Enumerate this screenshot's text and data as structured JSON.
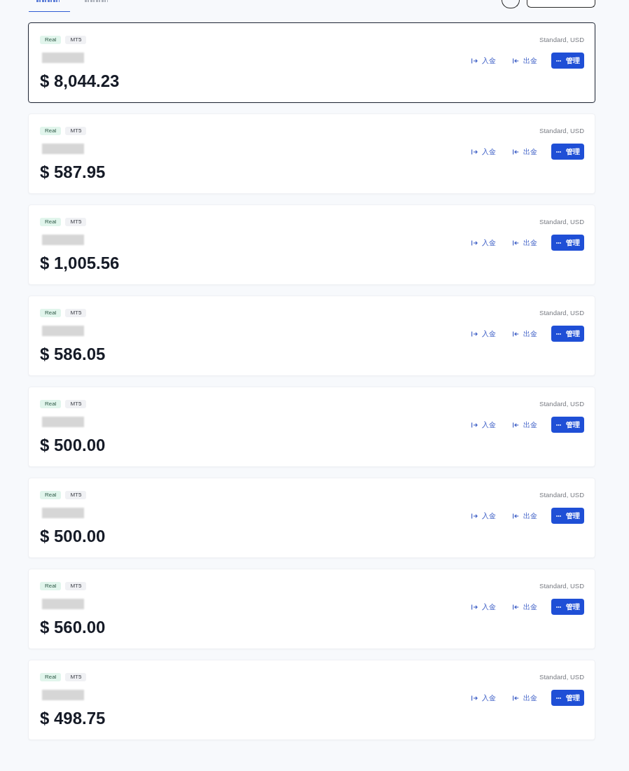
{
  "tabs": [
    {
      "selected": true
    },
    {
      "selected": false
    }
  ],
  "accounts": [
    {
      "selected": true,
      "tags": [
        {
          "label": "Real",
          "kind": "type"
        },
        {
          "label": "MT5",
          "kind": "platform"
        }
      ],
      "plan": "Standard, USD",
      "balance": "$ 8,044.23",
      "actions": [
        {
          "label": "入金",
          "kind": "deposit"
        },
        {
          "label": "出金",
          "kind": "withdraw"
        },
        {
          "label": "管理",
          "kind": "manage"
        }
      ]
    },
    {
      "selected": false,
      "tags": [
        {
          "label": "Real",
          "kind": "type"
        },
        {
          "label": "MT5",
          "kind": "platform"
        }
      ],
      "plan": "Standard, USD",
      "balance": "$ 587.95",
      "actions": [
        {
          "label": "入金",
          "kind": "deposit"
        },
        {
          "label": "出金",
          "kind": "withdraw"
        },
        {
          "label": "管理",
          "kind": "manage"
        }
      ]
    },
    {
      "selected": false,
      "tags": [
        {
          "label": "Real",
          "kind": "type"
        },
        {
          "label": "MT5",
          "kind": "platform"
        }
      ],
      "plan": "Standard, USD",
      "balance": "$ 1,005.56",
      "actions": [
        {
          "label": "入金",
          "kind": "deposit"
        },
        {
          "label": "出金",
          "kind": "withdraw"
        },
        {
          "label": "管理",
          "kind": "manage"
        }
      ]
    },
    {
      "selected": false,
      "tags": [
        {
          "label": "Real",
          "kind": "type"
        },
        {
          "label": "MT5",
          "kind": "platform"
        }
      ],
      "plan": "Standard, USD",
      "balance": "$ 586.05",
      "actions": [
        {
          "label": "入金",
          "kind": "deposit"
        },
        {
          "label": "出金",
          "kind": "withdraw"
        },
        {
          "label": "管理",
          "kind": "manage"
        }
      ]
    },
    {
      "selected": false,
      "tags": [
        {
          "label": "Real",
          "kind": "type"
        },
        {
          "label": "MT5",
          "kind": "platform"
        }
      ],
      "plan": "Standard, USD",
      "balance": "$ 500.00",
      "actions": [
        {
          "label": "入金",
          "kind": "deposit"
        },
        {
          "label": "出金",
          "kind": "withdraw"
        },
        {
          "label": "管理",
          "kind": "manage"
        }
      ]
    },
    {
      "selected": false,
      "tags": [
        {
          "label": "Real",
          "kind": "type"
        },
        {
          "label": "MT5",
          "kind": "platform"
        }
      ],
      "plan": "Standard, USD",
      "balance": "$ 500.00",
      "actions": [
        {
          "label": "入金",
          "kind": "deposit"
        },
        {
          "label": "出金",
          "kind": "withdraw"
        },
        {
          "label": "管理",
          "kind": "manage"
        }
      ]
    },
    {
      "selected": false,
      "tags": [
        {
          "label": "Real",
          "kind": "type"
        },
        {
          "label": "MT5",
          "kind": "platform"
        }
      ],
      "plan": "Standard, USD",
      "balance": "$ 560.00",
      "actions": [
        {
          "label": "入金",
          "kind": "deposit"
        },
        {
          "label": "出金",
          "kind": "withdraw"
        },
        {
          "label": "管理",
          "kind": "manage"
        }
      ]
    },
    {
      "selected": false,
      "tags": [
        {
          "label": "Real",
          "kind": "type"
        },
        {
          "label": "MT5",
          "kind": "platform"
        }
      ],
      "plan": "Standard, USD",
      "balance": "$ 498.75",
      "actions": [
        {
          "label": "入金",
          "kind": "deposit"
        },
        {
          "label": "出金",
          "kind": "withdraw"
        },
        {
          "label": "管理",
          "kind": "manage"
        }
      ]
    }
  ]
}
